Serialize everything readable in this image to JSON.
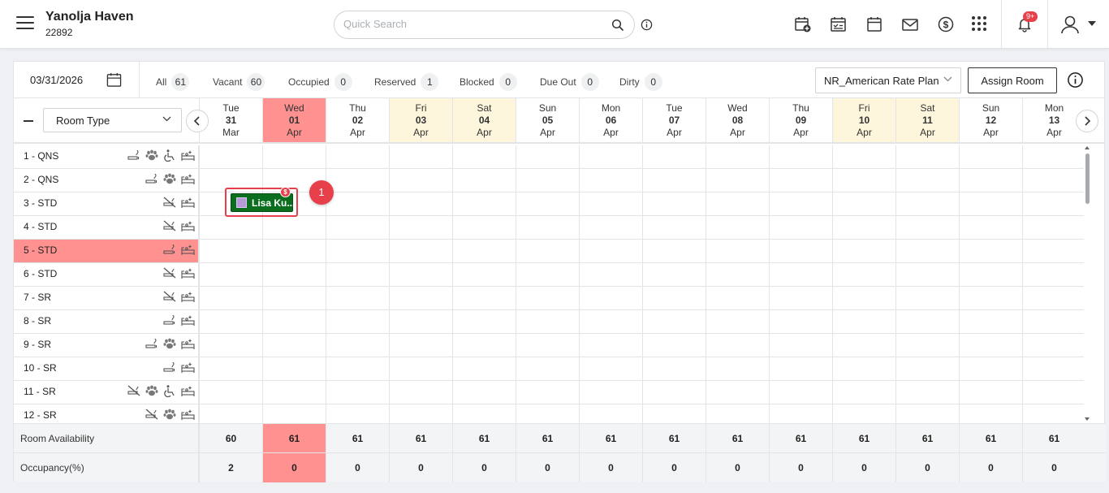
{
  "header": {
    "property_name": "Yanolja Haven",
    "property_id": "22892",
    "search_placeholder": "Quick Search",
    "notification_badge": "9+",
    "icons": [
      "calendar-add-icon",
      "calendar-check-icon",
      "calendar-icon",
      "mail-icon",
      "dollar-icon",
      "apps-grid-icon",
      "bell-icon",
      "user-icon"
    ]
  },
  "filters": {
    "date": "03/31/2026",
    "chips": [
      {
        "label": "All",
        "count": "61"
      },
      {
        "label": "Vacant",
        "count": "60"
      },
      {
        "label": "Occupied",
        "count": "0"
      },
      {
        "label": "Reserved",
        "count": "1"
      },
      {
        "label": "Blocked",
        "count": "0"
      },
      {
        "label": "Due Out",
        "count": "0"
      },
      {
        "label": "Dirty",
        "count": "0"
      }
    ],
    "rate_plan": "NR_American Rate Plan",
    "assign_button": "Assign Room"
  },
  "grid": {
    "room_type_label": "Room Type",
    "days": [
      {
        "dow": "Tue",
        "day": "31",
        "mon": "Mar",
        "kind": "normal"
      },
      {
        "dow": "Wed",
        "day": "01",
        "mon": "Apr",
        "kind": "today"
      },
      {
        "dow": "Thu",
        "day": "02",
        "mon": "Apr",
        "kind": "normal"
      },
      {
        "dow": "Fri",
        "day": "03",
        "mon": "Apr",
        "kind": "weekend"
      },
      {
        "dow": "Sat",
        "day": "04",
        "mon": "Apr",
        "kind": "weekend"
      },
      {
        "dow": "Sun",
        "day": "05",
        "mon": "Apr",
        "kind": "normal"
      },
      {
        "dow": "Mon",
        "day": "06",
        "mon": "Apr",
        "kind": "normal"
      },
      {
        "dow": "Tue",
        "day": "07",
        "mon": "Apr",
        "kind": "normal"
      },
      {
        "dow": "Wed",
        "day": "08",
        "mon": "Apr",
        "kind": "normal"
      },
      {
        "dow": "Thu",
        "day": "09",
        "mon": "Apr",
        "kind": "normal"
      },
      {
        "dow": "Fri",
        "day": "10",
        "mon": "Apr",
        "kind": "weekend"
      },
      {
        "dow": "Sat",
        "day": "11",
        "mon": "Apr",
        "kind": "weekend"
      },
      {
        "dow": "Sun",
        "day": "12",
        "mon": "Apr",
        "kind": "normal"
      },
      {
        "dow": "Mon",
        "day": "13",
        "mon": "Apr",
        "kind": "normal"
      }
    ],
    "rooms": [
      {
        "label": "1 - QNS",
        "icons": [
          "smoking-icon",
          "pet-icon",
          "accessible-icon",
          "bed-clean-icon"
        ],
        "highlight": false
      },
      {
        "label": "2 - QNS",
        "icons": [
          "smoking-icon",
          "pet-icon",
          "bed-clean-icon"
        ],
        "highlight": false
      },
      {
        "label": "3 - STD",
        "icons": [
          "no-smoking-icon",
          "bed-clean-icon"
        ],
        "highlight": false
      },
      {
        "label": "4 - STD",
        "icons": [
          "no-smoking-icon",
          "bed-clean-icon"
        ],
        "highlight": false
      },
      {
        "label": "5 - STD",
        "icons": [
          "smoking-icon",
          "bed-clean-icon"
        ],
        "highlight": true
      },
      {
        "label": "6 - STD",
        "icons": [
          "no-smoking-icon",
          "bed-clean-icon"
        ],
        "highlight": false
      },
      {
        "label": "7 - SR",
        "icons": [
          "no-smoking-icon",
          "bed-clean-icon"
        ],
        "highlight": false
      },
      {
        "label": "8 - SR",
        "icons": [
          "smoking-icon",
          "bed-clean-icon"
        ],
        "highlight": false
      },
      {
        "label": "9 - SR",
        "icons": [
          "smoking-icon",
          "pet-icon",
          "bed-clean-icon"
        ],
        "highlight": false
      },
      {
        "label": "10 - SR",
        "icons": [
          "smoking-icon",
          "bed-clean-icon"
        ],
        "highlight": false
      },
      {
        "label": "11 - SR",
        "icons": [
          "no-smoking-icon",
          "pet-icon",
          "accessible-icon",
          "bed-clean-icon"
        ],
        "highlight": false
      },
      {
        "label": "12 - SR",
        "icons": [
          "no-smoking-icon",
          "pet-icon",
          "bed-clean-icon"
        ],
        "highlight": false
      }
    ],
    "reservation": {
      "guest": "Lisa Ku...",
      "badge": "$",
      "step": "1"
    },
    "availability_label": "Room Availability",
    "availability": [
      "60",
      "61",
      "61",
      "61",
      "61",
      "61",
      "61",
      "61",
      "61",
      "61",
      "61",
      "61",
      "61",
      "61"
    ],
    "occupancy_label": "Occupancy(%)",
    "occupancy": [
      "2",
      "0",
      "0",
      "0",
      "0",
      "0",
      "0",
      "0",
      "0",
      "0",
      "0",
      "0",
      "0",
      "0"
    ]
  },
  "colors": {
    "today": "#ff9191",
    "weekend": "#fdf6dc",
    "reservation": "#0b6e1f",
    "accent_red": "#e8404b"
  }
}
